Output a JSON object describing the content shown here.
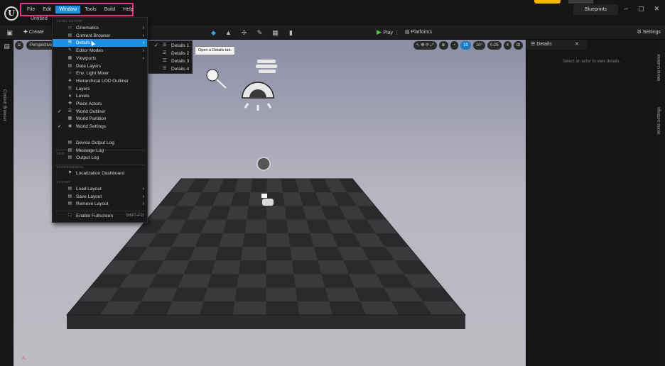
{
  "titlebar": {
    "menus": [
      "File",
      "Edit",
      "Window",
      "Tools",
      "Build",
      "Help"
    ],
    "active_menu": "Window",
    "project_tab": "Untitled",
    "blueprints_tab": "Blueprints",
    "controls": [
      "–",
      "▢",
      "✕"
    ]
  },
  "toolbar": {
    "create_label": "Create",
    "play_label": "Play",
    "platforms_label": "Platforms",
    "settings_label": "Settings"
  },
  "left_strip": {
    "content_browser_label": "Content Browser"
  },
  "viewport": {
    "perspective_label": "Perspective",
    "tools": [
      "10",
      "10°",
      "0.25",
      "4"
    ],
    "axis_label": "z"
  },
  "window_menu": {
    "sections": {
      "level_editor": "LEVEL EDITOR",
      "log": "LOG",
      "experimental": "EXPERIMENTAL",
      "layout": "LAYOUT"
    },
    "level_items": [
      {
        "label": "Cinematics",
        "sub": true,
        "checked": false,
        "highlighted": false
      },
      {
        "label": "Content Browser",
        "sub": true,
        "checked": false,
        "highlighted": false
      },
      {
        "label": "Details",
        "sub": true,
        "checked": false,
        "highlighted": true
      },
      {
        "label": "Editor Modes",
        "sub": true,
        "checked": false,
        "highlighted": false
      },
      {
        "label": "Viewports",
        "sub": true,
        "checked": false,
        "highlighted": false
      },
      {
        "label": "Data Layers",
        "sub": false,
        "checked": false,
        "highlighted": false
      },
      {
        "label": "Env. Light Mixer",
        "sub": false,
        "checked": false,
        "highlighted": false
      },
      {
        "label": "Hierarchical LOD Outliner",
        "sub": false,
        "checked": false,
        "highlighted": false
      },
      {
        "label": "Layers",
        "sub": false,
        "checked": false,
        "highlighted": false
      },
      {
        "label": "Levels",
        "sub": false,
        "checked": false,
        "highlighted": false
      },
      {
        "label": "Place Actors",
        "sub": false,
        "checked": false,
        "highlighted": false
      },
      {
        "label": "World Outliner",
        "sub": false,
        "checked": true,
        "highlighted": false
      },
      {
        "label": "World Partition",
        "sub": false,
        "checked": false,
        "highlighted": false
      },
      {
        "label": "World Settings",
        "sub": false,
        "checked": true,
        "highlighted": false
      }
    ],
    "log_items": [
      "Device Output Log",
      "Message Log",
      "Output Log"
    ],
    "experimental_items": [
      "Localization Dashboard"
    ],
    "layout_items": [
      "Load Layout",
      "Save Layout",
      "Remove Layout"
    ],
    "fullscreen": {
      "label": "Enable Fullscreen",
      "shortcut": "SHIFT+F11"
    }
  },
  "details_submenu": {
    "items": [
      {
        "label": "Details 1",
        "checked": true
      },
      {
        "label": "Details 2",
        "checked": false
      },
      {
        "label": "Details 3",
        "checked": false
      },
      {
        "label": "Details 4",
        "checked": false
      }
    ],
    "tooltip": "Open a Details tab."
  },
  "right_panel": {
    "details_tab": "Details",
    "empty_message": "Select an actor to view details.",
    "world_outliner_label": "World Outliner",
    "world_settings_label": "World Settings"
  },
  "colors": {
    "accent": "#1d8fe1",
    "menubar_highlight_border": "#e8338a",
    "play_green": "#4ec44b"
  }
}
